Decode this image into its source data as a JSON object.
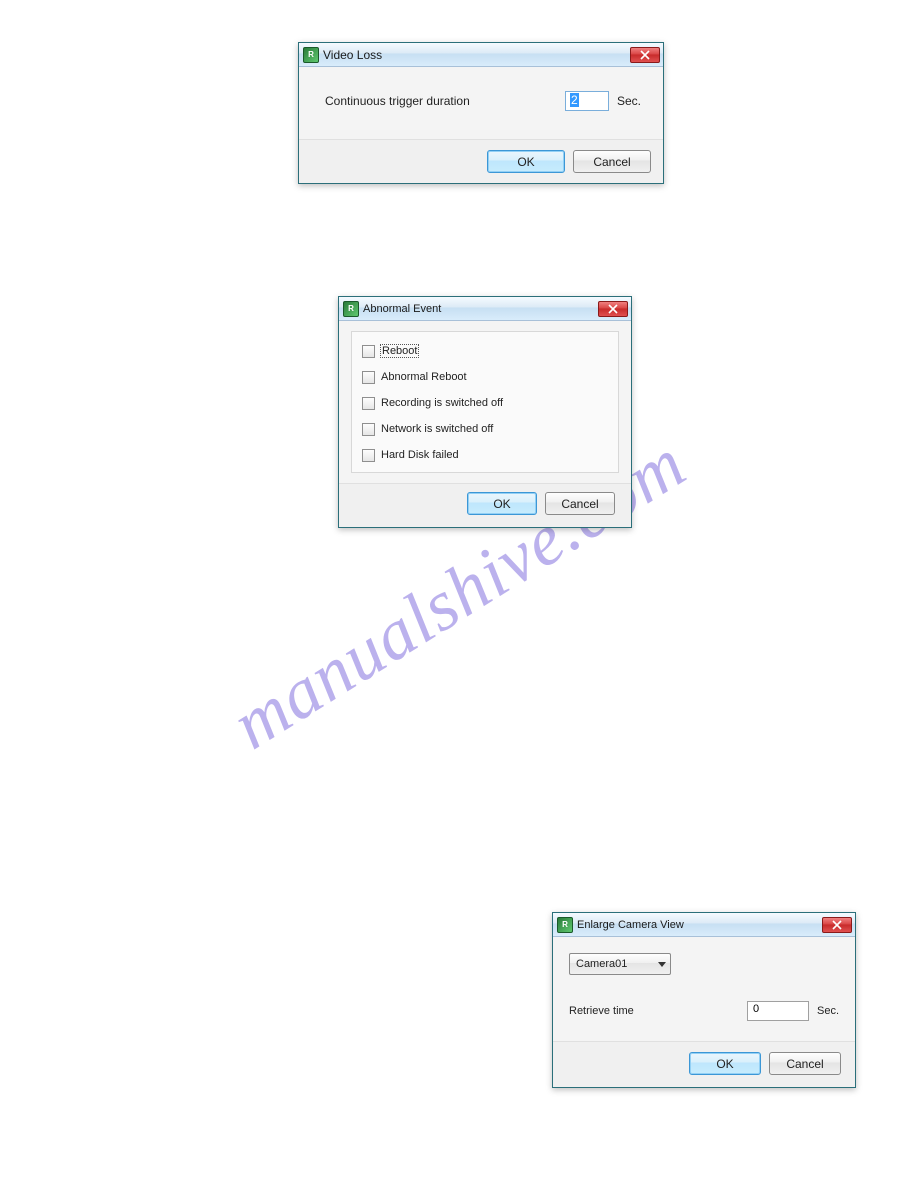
{
  "watermark": "manualshive.com",
  "dialog1": {
    "title": "Video Loss",
    "field_label": "Continuous trigger duration",
    "field_value": "2",
    "field_unit": "Sec.",
    "ok": "OK",
    "cancel": "Cancel"
  },
  "dialog2": {
    "title": "Abnormal Event",
    "options": [
      {
        "label": "Reboot",
        "checked": false,
        "focused": true
      },
      {
        "label": "Abnormal Reboot",
        "checked": false,
        "focused": false
      },
      {
        "label": "Recording is switched off",
        "checked": false,
        "focused": false
      },
      {
        "label": "Network is switched off",
        "checked": false,
        "focused": false
      },
      {
        "label": "Hard Disk failed",
        "checked": false,
        "focused": false
      }
    ],
    "ok": "OK",
    "cancel": "Cancel"
  },
  "dialog3": {
    "title": "Enlarge Camera View",
    "camera_selected": "Camera01",
    "retrieve_label": "Retrieve time",
    "retrieve_value": "0",
    "retrieve_unit": "Sec.",
    "ok": "OK",
    "cancel": "Cancel"
  }
}
